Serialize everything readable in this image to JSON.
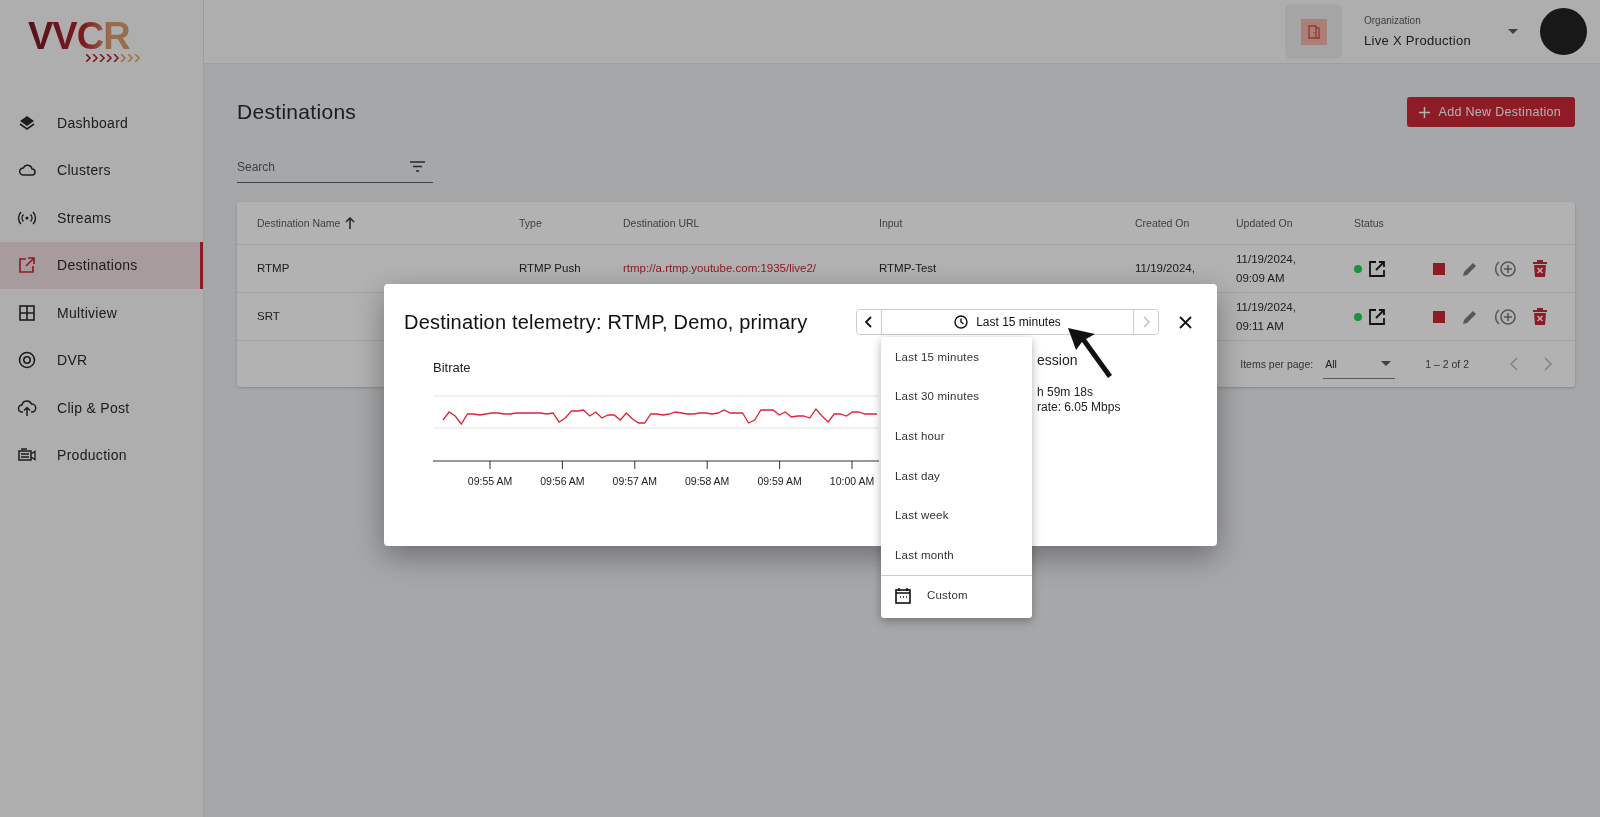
{
  "logo": {
    "text": "VVCR"
  },
  "nav": {
    "items": [
      {
        "label": "Dashboard",
        "selected": false
      },
      {
        "label": "Clusters",
        "selected": false
      },
      {
        "label": "Streams",
        "selected": false
      },
      {
        "label": "Destinations",
        "selected": true
      },
      {
        "label": "Multiview",
        "selected": false
      },
      {
        "label": "DVR",
        "selected": false
      },
      {
        "label": "Clip & Post",
        "selected": false
      },
      {
        "label": "Production",
        "selected": false
      }
    ]
  },
  "header": {
    "organization_label": "Organization",
    "organization": "Live X Production"
  },
  "page": {
    "title": "Destinations",
    "add_button": "Add New Destination",
    "search": {
      "placeholder": "Search"
    }
  },
  "table": {
    "columns": [
      {
        "label": "Destination Name",
        "sorted": true
      },
      {
        "label": "Type",
        "sorted": false
      },
      {
        "label": "Destination URL",
        "sorted": false
      },
      {
        "label": "Input",
        "sorted": false
      },
      {
        "label": "Created On",
        "sorted": false
      },
      {
        "label": "Updated On",
        "sorted": false
      },
      {
        "label": "Status",
        "sorted": false
      }
    ],
    "rows": [
      {
        "name": "RTMP",
        "type": "RTMP Push",
        "url": "rtmp://a.rtmp.youtube.com:1935/live2/",
        "input": "RTMP-Test",
        "created": [
          "11/19/2024,"
        ],
        "updated": [
          "11/19/2024,",
          "09:09 AM"
        ],
        "color": "#1a9436"
      },
      {
        "name": "SRT",
        "type": "",
        "url": "",
        "input": "",
        "created": [],
        "updated": [
          "11/19/2024,",
          "09:11 AM"
        ],
        "color": "#1a9436"
      }
    ],
    "footer": {
      "items_per_page_label": "Items per page:",
      "items_per_page": "All",
      "range": "1 – 2 of 2",
      "prev_disabled": true,
      "next_disabled": true
    }
  },
  "dialog": {
    "title": "Destination telemetry: RTMP, Demo, primary",
    "time_range": "Last 15 minutes",
    "prev_disabled": false,
    "next_disabled": true,
    "chart": {
      "title": "Bitrate",
      "x_ticks": [
        "09:55 AM",
        "09:56 AM",
        "09:57 AM",
        "09:58 AM",
        "09:59 AM",
        "10:00 AM"
      ]
    },
    "session": {
      "heading": "ession",
      "lines": [
        "h 59m 18s",
        "rate: 6.05 Mbps"
      ]
    },
    "menu": {
      "items": [
        {
          "label": "Last 15 minutes",
          "kind": "preset",
          "selected": false
        },
        {
          "label": "Last 30 minutes",
          "kind": "preset",
          "selected": false
        },
        {
          "label": "Last hour",
          "kind": "preset",
          "selected": false
        },
        {
          "label": "Last day",
          "kind": "preset",
          "selected": false
        },
        {
          "label": "Last week",
          "kind": "preset",
          "selected": false
        },
        {
          "label": "Last month",
          "kind": "preset",
          "selected": false
        },
        {
          "label": "Custom",
          "kind": "custom",
          "selected": false
        }
      ]
    }
  }
}
